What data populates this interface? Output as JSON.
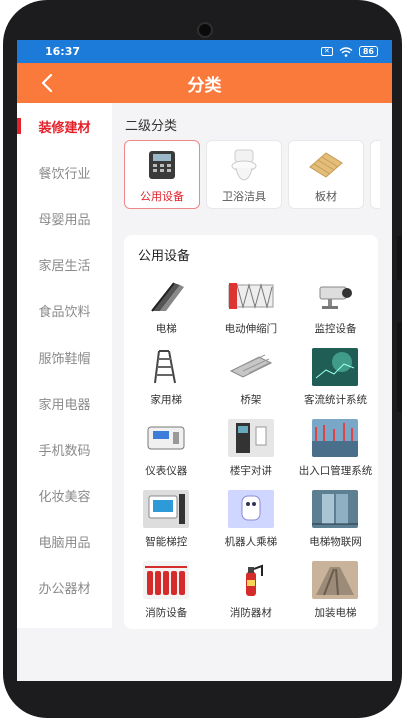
{
  "status": {
    "time": "16:37",
    "battery": "86"
  },
  "header": {
    "title": "分类"
  },
  "sidebar": {
    "items": [
      {
        "label": "装修建材",
        "active": true
      },
      {
        "label": "餐饮行业"
      },
      {
        "label": "母婴用品"
      },
      {
        "label": "家居生活"
      },
      {
        "label": "食品饮料"
      },
      {
        "label": "服饰鞋帽"
      },
      {
        "label": "家用电器"
      },
      {
        "label": "手机数码"
      },
      {
        "label": "化妆美容"
      },
      {
        "label": "电脑用品"
      },
      {
        "label": "办公器材"
      }
    ]
  },
  "main": {
    "section_title": "二级分类",
    "subcategories": [
      {
        "label": "公用设备",
        "icon": "phone-device-icon",
        "active": true
      },
      {
        "label": "卫浴洁具",
        "icon": "toilet-icon"
      },
      {
        "label": "板材",
        "icon": "wood-board-icon"
      }
    ],
    "panel_title": "公用设备",
    "items": [
      {
        "label": "电梯",
        "icon": "escalator-icon"
      },
      {
        "label": "电动伸缩门",
        "icon": "retractable-gate-icon"
      },
      {
        "label": "监控设备",
        "icon": "cctv-camera-icon"
      },
      {
        "label": "家用梯",
        "icon": "ladder-icon"
      },
      {
        "label": "桥架",
        "icon": "cable-tray-icon"
      },
      {
        "label": "客流统计系统",
        "icon": "people-counter-icon"
      },
      {
        "label": "仪表仪器",
        "icon": "meter-icon"
      },
      {
        "label": "楼宇对讲",
        "icon": "intercom-icon"
      },
      {
        "label": "出入口管理系统",
        "icon": "access-control-icon"
      },
      {
        "label": "智能梯控",
        "icon": "smart-elevator-panel-icon"
      },
      {
        "label": "机器人乘梯",
        "icon": "robot-elevator-icon"
      },
      {
        "label": "电梯物联网",
        "icon": "elevator-iot-icon"
      },
      {
        "label": "消防设备",
        "icon": "fire-equipment-icon"
      },
      {
        "label": "消防器材",
        "icon": "fire-extinguisher-icon"
      },
      {
        "label": "加装电梯",
        "icon": "install-elevator-icon"
      }
    ]
  },
  "colors": {
    "accent": "#fa7a3c",
    "statusbar": "#1c7bd8",
    "active": "#e3222a"
  }
}
